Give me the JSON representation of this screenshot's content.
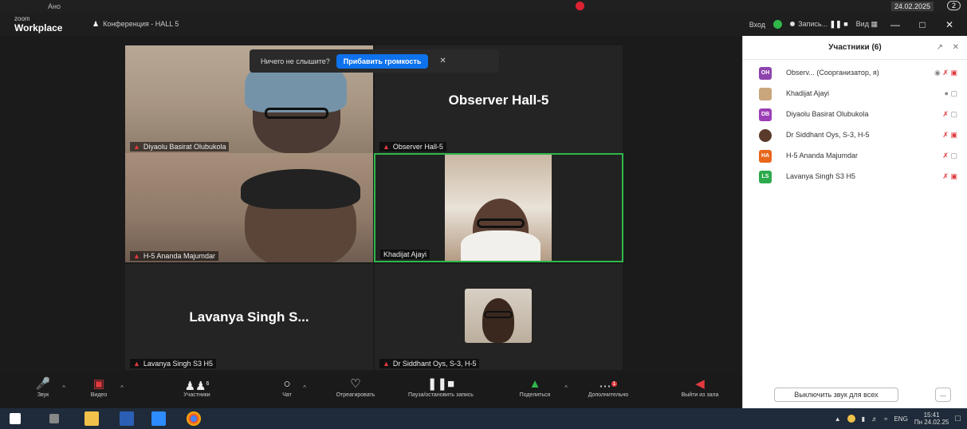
{
  "os_top": {
    "search_text": "Ано",
    "date": "24.02.2025",
    "notifications": "2"
  },
  "titlebar": {
    "logo_small": "zoom",
    "logo_big": "Workplace",
    "meeting_title": "Конференция - HALL 5",
    "enter": "Вход",
    "recording": "Запись...",
    "view": "Вид"
  },
  "notification": {
    "message": "Ничего не слышите?",
    "button": "Прибавить громкость"
  },
  "tiles": [
    {
      "name": "Diyaolu Basirat Olubukola",
      "video": true
    },
    {
      "name": "Observer Hall-5",
      "big_label": "Observer  Hall-5",
      "video": false
    },
    {
      "name": "H-5 Ananda Majumdar",
      "video": true
    },
    {
      "name": "Khadijat Ajayi",
      "video": true
    },
    {
      "name": "Lavanya Singh S3 H5",
      "big_label": "Lavanya Singh S...",
      "video": false
    },
    {
      "name": "Dr Siddhant Oys, S-3, H-5",
      "video": false
    }
  ],
  "panel": {
    "title": "Участники (6)",
    "participants": [
      {
        "initials": "OH",
        "color": "#8d44ad",
        "name": "Observ...  (Соорганизатор, я)"
      },
      {
        "initials": "",
        "color": "#c9a67c",
        "name": "Khadijat Ajayi"
      },
      {
        "initials": "DB",
        "color": "#9b3fb5",
        "name": "Diyaolu Basirat Olubukola"
      },
      {
        "initials": "",
        "color": "#5a3a2a",
        "name": "Dr Siddhant Oys, S-3, H-5"
      },
      {
        "initials": "HA",
        "color": "#e8671c",
        "name": "H-5 Ananda Majumdar"
      },
      {
        "initials": "LS",
        "color": "#2eaa4d",
        "name": "Lavanya Singh S3 H5"
      }
    ],
    "mute_all": "Выключить звук для всех",
    "more": "..."
  },
  "toolbar": {
    "audio": "Звук",
    "video": "Видео",
    "participants": "Участники",
    "participants_count": "6",
    "chat": "Чат",
    "react": "Отреагировать",
    "record": "Пауза/остановить запись",
    "share": "Поделиться",
    "more": "Дополнительно",
    "more_badge": "1",
    "leave": "Выйти из зала"
  },
  "taskbar": {
    "lang": "ENG",
    "time": "15:41",
    "date": "Пн 24.02.25"
  }
}
